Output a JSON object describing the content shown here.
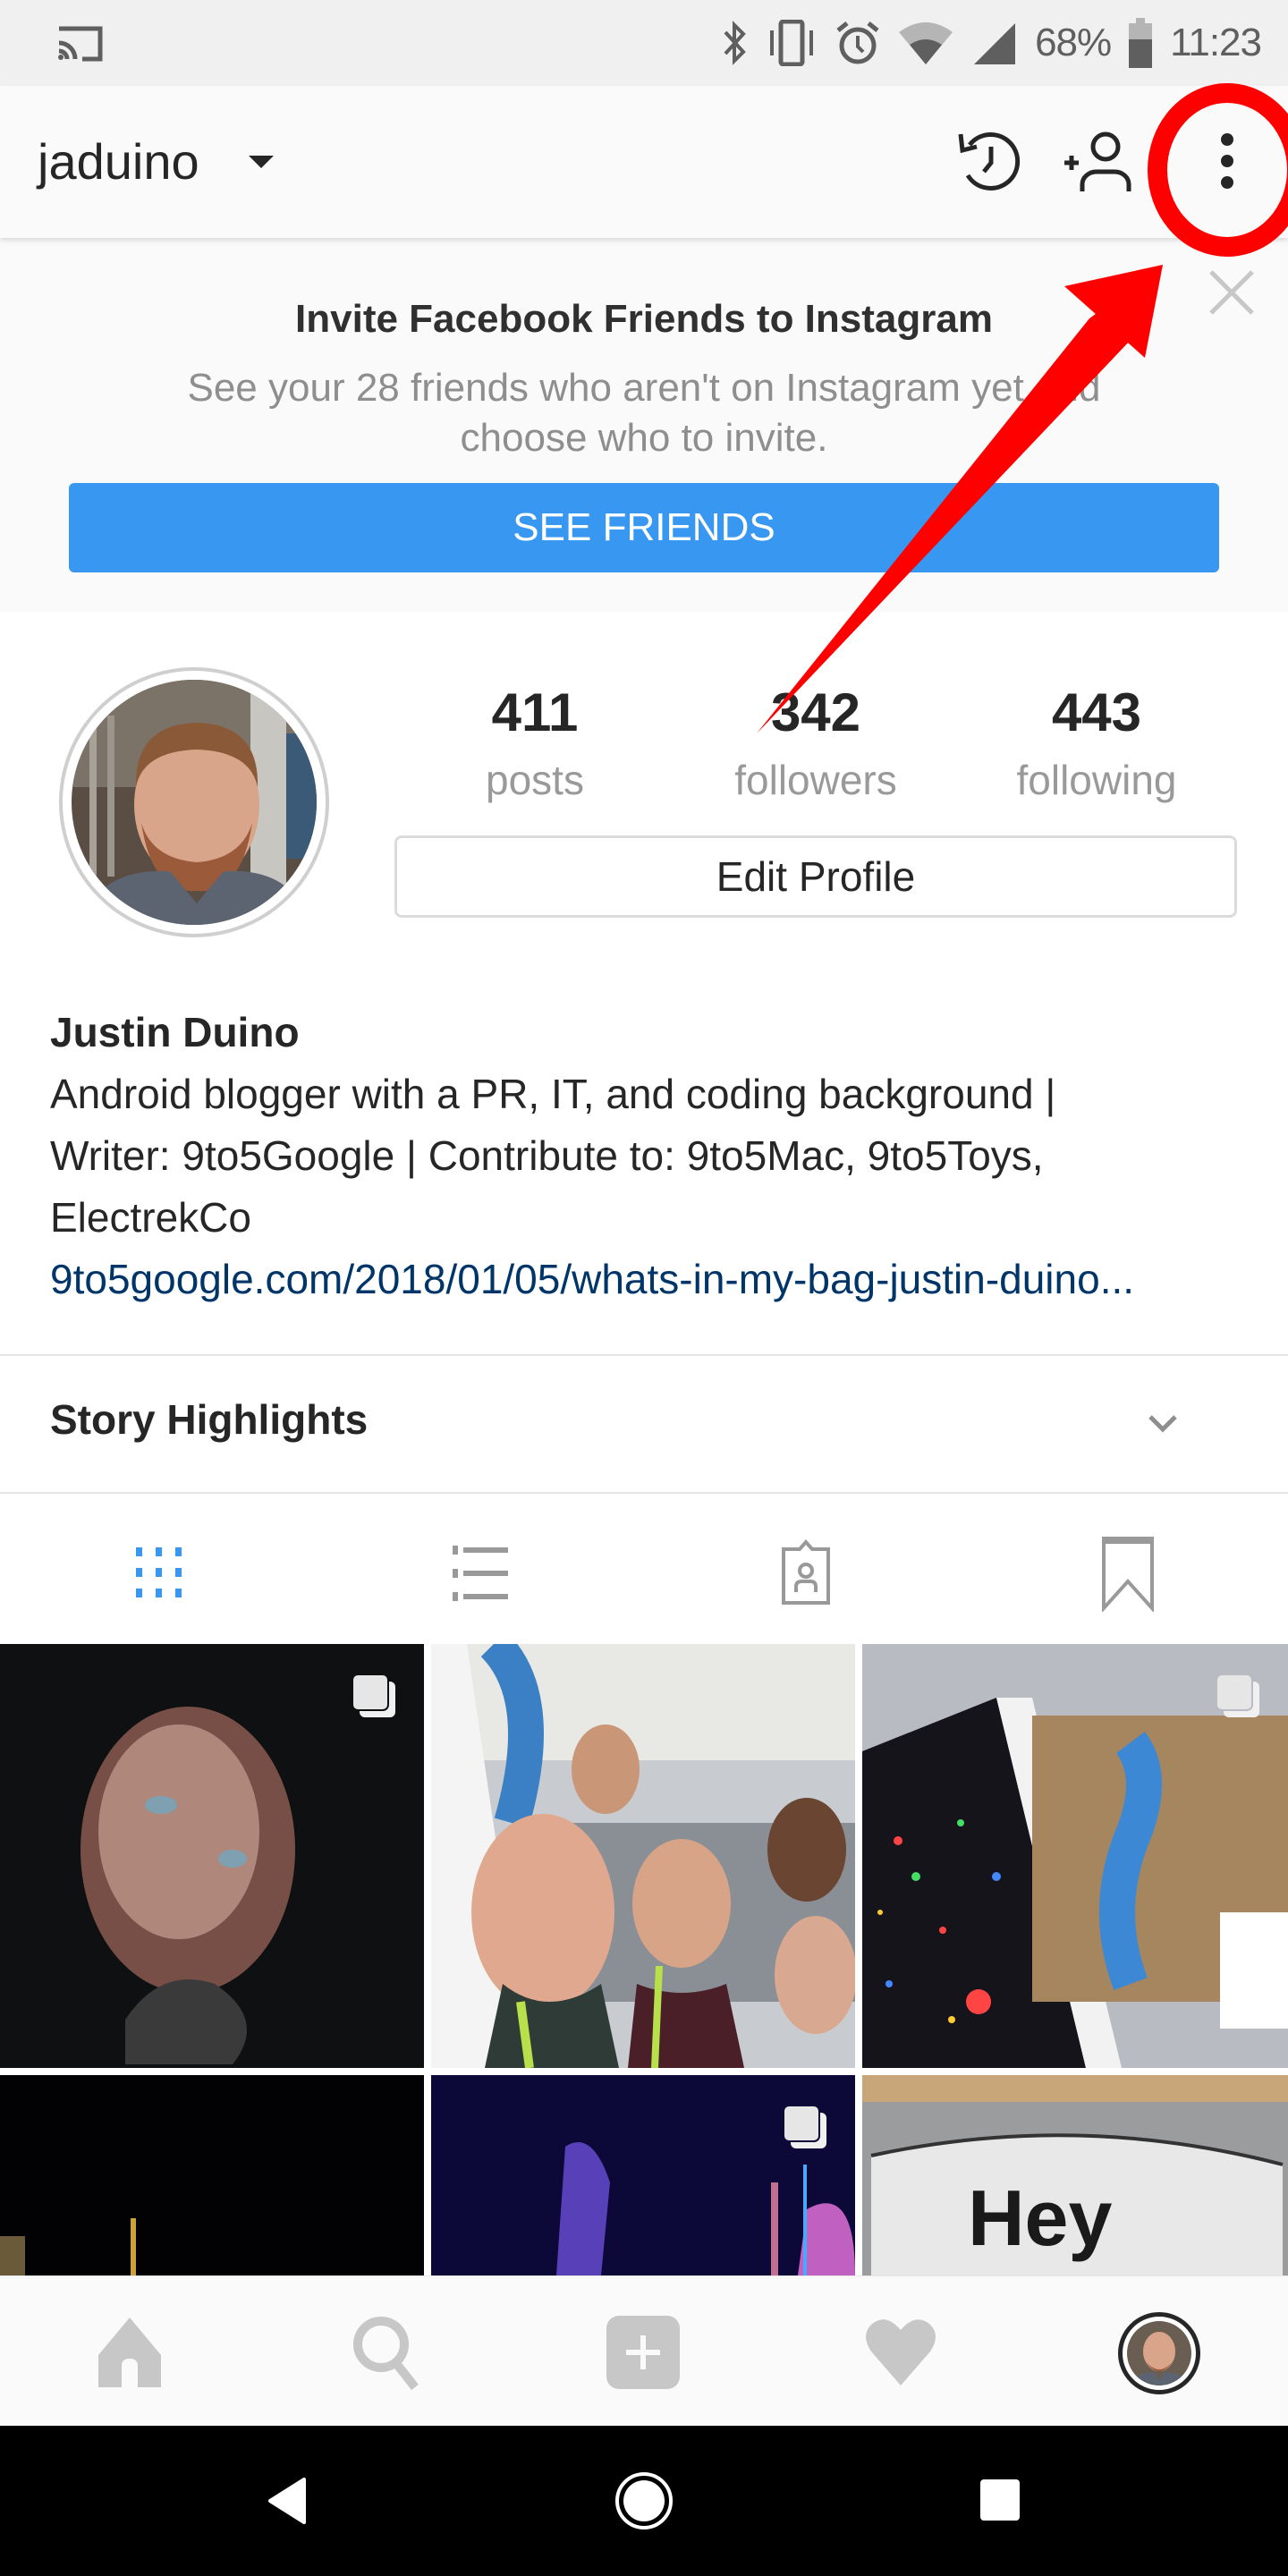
{
  "status_bar": {
    "battery_percent": "68%",
    "time": "11:23",
    "icons": [
      "cast-icon",
      "bluetooth-icon",
      "vibrate-icon",
      "alarm-icon",
      "wifi-icon",
      "cell-signal-icon",
      "battery-icon"
    ]
  },
  "header": {
    "username": "jaduino",
    "icons": [
      "account-switch-caret-icon",
      "archive-history-icon",
      "discover-people-icon",
      "more-options-icon"
    ]
  },
  "banner": {
    "title": "Invite Facebook Friends to Instagram",
    "description": "See your 28 friends who aren't on Instagram yet and choose who to invite.",
    "button_label": "SEE FRIENDS",
    "button_color": "#3897f0"
  },
  "profile": {
    "stats": [
      {
        "value": "411",
        "label": "posts"
      },
      {
        "value": "342",
        "label": "followers"
      },
      {
        "value": "443",
        "label": "following"
      }
    ],
    "edit_button_label": "Edit Profile",
    "full_name": "Justin Duino",
    "bio_lines": [
      "Android blogger with a PR, IT, and coding background |",
      "Writer: 9to5Google | Contribute to: 9to5Mac, 9to5Toys,",
      "ElectrekCo"
    ],
    "link": "9to5google.com/2018/01/05/whats-in-my-bag-justin-duino..."
  },
  "highlights": {
    "title": "Story Highlights"
  },
  "tabs": [
    {
      "name": "grid",
      "active": true
    },
    {
      "name": "list",
      "active": false
    },
    {
      "name": "tagged",
      "active": false
    },
    {
      "name": "saved",
      "active": false
    }
  ],
  "grid_posts": [
    {
      "description": "Child's face lit by screen in dark",
      "multi": true
    },
    {
      "description": "Group selfie at conference",
      "multi": false
    },
    {
      "description": "Building with colorful light wall and blue slide",
      "multi": true
    },
    {
      "description": "Night city skyline",
      "multi": false
    },
    {
      "description": "Purple-lit stage",
      "multi": true
    },
    {
      "description": "Hey Google sign",
      "multi": false,
      "text": "Hey Google"
    }
  ],
  "bottom_nav": [
    "home",
    "search",
    "new-post",
    "activity",
    "profile"
  ],
  "annotation": {
    "color": "#ff0000",
    "target": "more-options-button"
  },
  "accent_colors": {
    "active_tab": "#3897f0",
    "link": "#003569",
    "muted": "#999999"
  }
}
